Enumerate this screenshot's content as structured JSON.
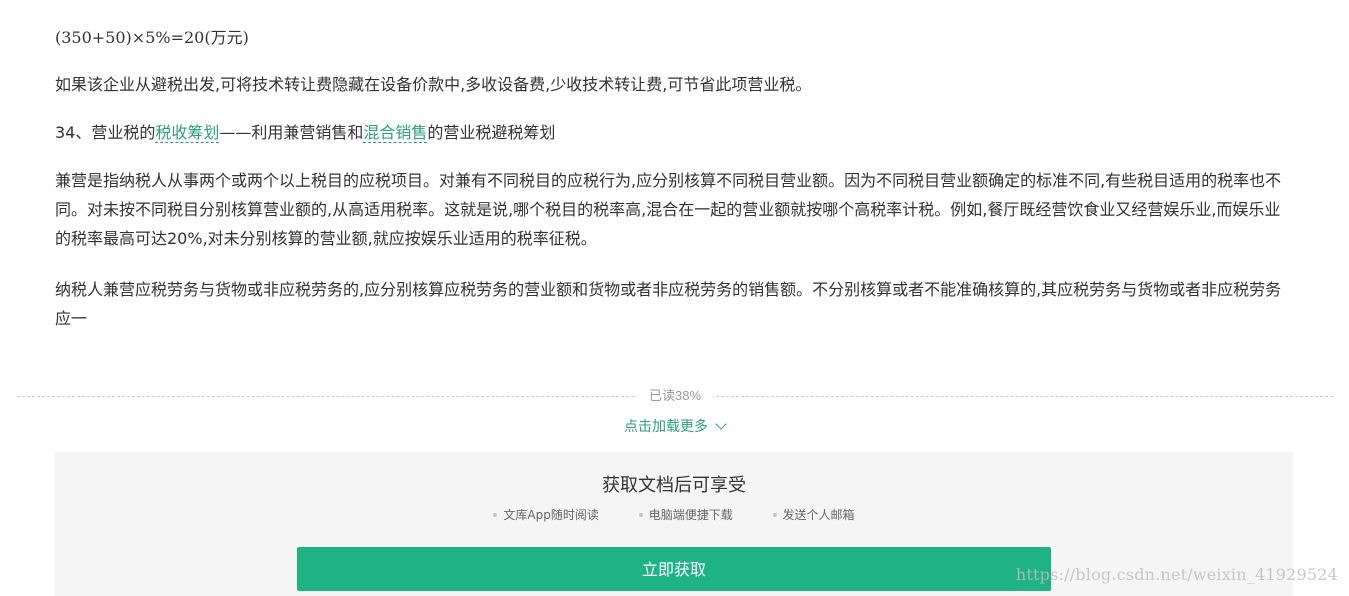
{
  "article": {
    "formula": "(350+50)×5%=20(万元)",
    "para_avoid": "如果该企业从避税出发,可将技术转让费隐藏在设备价款中,多收设备费,少收技术转让费,可节省此项营业税。",
    "heading_prefix": "34、营业税的",
    "heading_link1": "税收筹划",
    "heading_middle": "——利用兼营销售和",
    "heading_link2": "混合销售",
    "heading_suffix": "的营业税避税筹划",
    "para_concurrent": "兼营是指纳税人从事两个或两个以上税目的应税项目。对兼有不同税目的应税行为,应分别核算不同税目营业额。因为不同税目营业额确定的标准不同,有些税目适用的税率也不同。对未按不同税目分别核算营业额的,从高适用税率。这就是说,哪个税目的税率高,混合在一起的营业额就按哪个高税率计税。例如,餐厅既经营饮食业又经营娱乐业,而娱乐业的税率最高可达20%,对未分别核算的营业额,就应按娱乐业适用的税率征税。",
    "para_taxpayer": "纳税人兼营应税劳务与货物或非应税劳务的,应分别核算应税劳务的营业额和货物或者非应税劳务的销售额。不分别核算或者不能准确核算的,其应税劳务与货物或者非应税劳务应一"
  },
  "reader": {
    "progress_label": "已读38%",
    "load_more_label": "点击加载更多"
  },
  "promo": {
    "title": "获取文档后可享受",
    "features": [
      "文库App随时阅读",
      "电脑端便捷下载",
      "发送个人邮箱"
    ],
    "button_label": "立即获取"
  },
  "watermark": "https://blog.csdn.net/weixin_41929524",
  "colors": {
    "accent": "#1fb383",
    "link": "#2da07c",
    "text": "#333333",
    "muted": "#999999",
    "panel_bg": "#f5f5f5"
  },
  "icons": {
    "load_more": "chevron-down-icon",
    "feature_bullet": "dot-icon"
  }
}
